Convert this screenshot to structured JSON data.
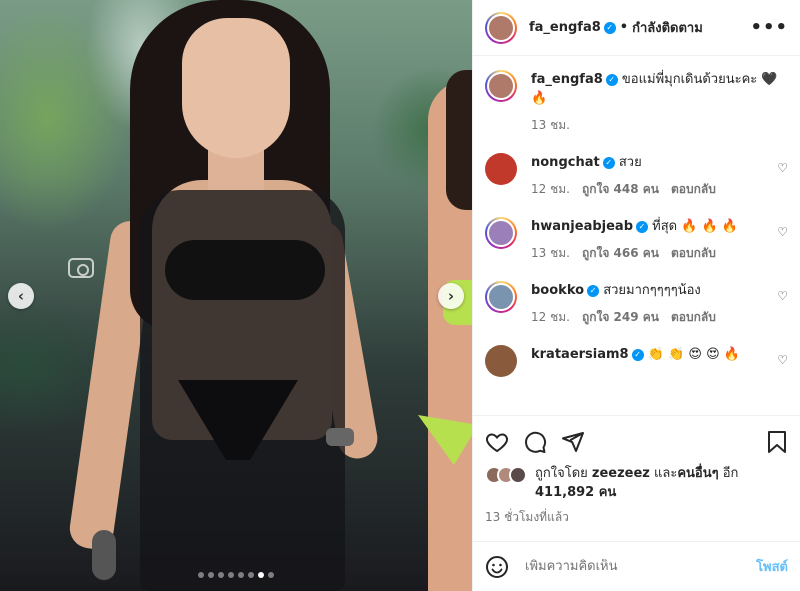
{
  "post": {
    "carousel": {
      "slide_count": 8,
      "active_index": 6
    }
  },
  "header": {
    "username": "fa_engfa8",
    "separator": "•",
    "follow_status": "กำลังติดตาม",
    "more_label": "•••"
  },
  "caption": {
    "username": "fa_engfa8",
    "text": "ขอแม่พี่มุกเดินด้วยนะคะ 🖤 🔥",
    "time": "13 ชม."
  },
  "comments": [
    {
      "username": "nongchat",
      "text": "สวย",
      "time": "12 ชม.",
      "likes": "ถูกใจ 448 คน",
      "reply": "ตอบกลับ",
      "avatar_color": "#c0392b"
    },
    {
      "username": "hwanjeabjeab",
      "text": "ที่สุด 🔥 🔥 🔥",
      "time": "13 ชม.",
      "likes": "ถูกใจ 466 คน",
      "reply": "ตอบกลับ",
      "avatar_color": "#9b7fb8"
    },
    {
      "username": "bookko",
      "text": "สวยมากๆๆๆๆน้อง",
      "time": "12 ชม.",
      "likes": "ถูกใจ 249 คน",
      "reply": "ตอบกลับ",
      "avatar_color": "#7a94b0"
    },
    {
      "username": "krataersiam8",
      "text": "👏 👏 😍 😍 🔥",
      "time": "",
      "likes": "",
      "reply": "",
      "avatar_color": "#8a5a3c"
    }
  ],
  "likes": {
    "prefix": "ถูกใจโดย",
    "user": "zeezeez",
    "middle": "และ",
    "others": "คนอื่นๆ",
    "suffix": "อีก",
    "count": "411,892 คน"
  },
  "post_time": "13 ชั่วโมงที่แล้ว",
  "add_comment": {
    "placeholder": "เพิ่มความคิดเห็น",
    "post_label": "โพสต์"
  },
  "colors": {
    "verified": "#0095f6",
    "text": "#262626",
    "muted": "#737373",
    "accent_link": "#0095f6"
  },
  "icons": {
    "like": "heart-icon",
    "comment": "comment-icon",
    "share": "send-icon",
    "save": "bookmark-icon",
    "emoji": "smiley-icon",
    "comment_like": "small-heart-icon"
  }
}
